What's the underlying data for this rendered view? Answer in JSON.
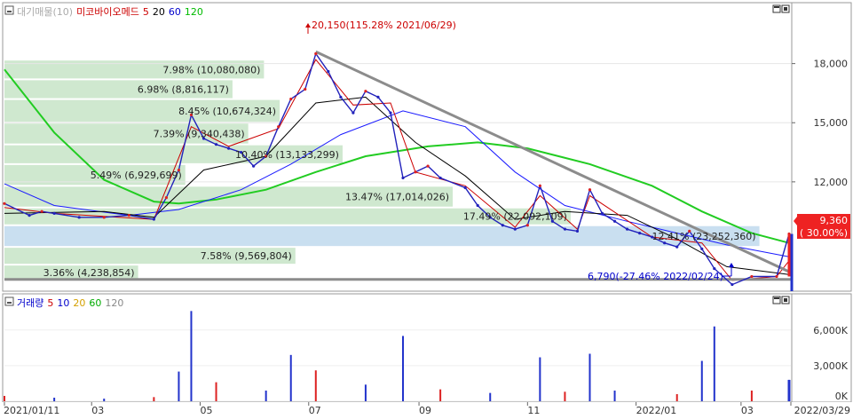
{
  "price_panel": {
    "legend": [
      {
        "text": "대기매물(10)",
        "color": "#aaaaaa"
      },
      {
        "text": "미코바이오메드",
        "color": "#cc0000"
      },
      {
        "text": "5",
        "color": "#cc0000"
      },
      {
        "text": "20",
        "color": "#000000"
      },
      {
        "text": "60",
        "color": "#0000cc"
      },
      {
        "text": "120",
        "color": "#00bb00"
      }
    ],
    "y_ticks": [
      {
        "value": 18000,
        "label": "18,000"
      },
      {
        "value": 15000,
        "label": "15,000"
      },
      {
        "value": 12000,
        "label": "12,000"
      }
    ],
    "high_label": "20,150(115.28% 2021/06/29)",
    "low_label": "6,790(-27.46% 2022/02/24)",
    "current_price": "9,360",
    "current_change": "( 30.00%)"
  },
  "volume_panel": {
    "legend": [
      {
        "text": "거래량",
        "color": "#0000cc"
      },
      {
        "text": "5",
        "color": "#cc0000"
      },
      {
        "text": "10",
        "color": "#0000cc"
      },
      {
        "text": "20",
        "color": "#d4a000"
      },
      {
        "text": "60",
        "color": "#00aa00"
      },
      {
        "text": "120",
        "color": "#888888"
      }
    ],
    "y_ticks": [
      {
        "value": 6000000,
        "label": "6,000K"
      },
      {
        "value": 3000000,
        "label": "3,000K"
      },
      {
        "value": 0,
        "label": "0K"
      }
    ]
  },
  "x_axis": {
    "labels": [
      "2021/01/11",
      "03",
      "05",
      "07",
      "09",
      "11",
      "2022/01",
      "03",
      "2022/03/29"
    ]
  },
  "chart_data": {
    "type": "line",
    "date_range": [
      "2021/01/11",
      "2022/03/29"
    ],
    "price_ylim": [
      6500,
      21000
    ],
    "volume_ylim": [
      0,
      8000000
    ],
    "price_series": [
      {
        "date": "2021/01/11",
        "close": 10900
      },
      {
        "date": "2021/01/25",
        "close": 10300
      },
      {
        "date": "2021/02/01",
        "close": 10500
      },
      {
        "date": "2021/02/08",
        "close": 10400
      },
      {
        "date": "2021/02/22",
        "close": 10200
      },
      {
        "date": "2021/03/08",
        "close": 10200
      },
      {
        "date": "2021/03/22",
        "close": 10300
      },
      {
        "date": "2021/04/05",
        "close": 10100
      },
      {
        "date": "2021/04/12",
        "close": 11200
      },
      {
        "date": "2021/04/19",
        "close": 12600
      },
      {
        "date": "2021/04/26",
        "close": 15400
      },
      {
        "date": "2021/05/03",
        "close": 14200
      },
      {
        "date": "2021/05/10",
        "close": 13900
      },
      {
        "date": "2021/05/17",
        "close": 13700
      },
      {
        "date": "2021/05/24",
        "close": 13500
      },
      {
        "date": "2021/05/31",
        "close": 12800
      },
      {
        "date": "2021/06/07",
        "close": 13300
      },
      {
        "date": "2021/06/14",
        "close": 14800
      },
      {
        "date": "2021/06/21",
        "close": 16200
      },
      {
        "date": "2021/06/29",
        "close": 16700
      },
      {
        "date": "2021/07/05",
        "close": 18500
      },
      {
        "date": "2021/07/12",
        "close": 17600
      },
      {
        "date": "2021/07/19",
        "close": 16300
      },
      {
        "date": "2021/07/26",
        "close": 15500
      },
      {
        "date": "2021/08/02",
        "close": 16600
      },
      {
        "date": "2021/08/09",
        "close": 16300
      },
      {
        "date": "2021/08/16",
        "close": 15500
      },
      {
        "date": "2021/08/23",
        "close": 12200
      },
      {
        "date": "2021/08/30",
        "close": 12500
      },
      {
        "date": "2021/09/06",
        "close": 12800
      },
      {
        "date": "2021/09/13",
        "close": 12200
      },
      {
        "date": "2021/09/27",
        "close": 11700
      },
      {
        "date": "2021/10/04",
        "close": 10800
      },
      {
        "date": "2021/10/11",
        "close": 10200
      },
      {
        "date": "2021/10/18",
        "close": 9800
      },
      {
        "date": "2021/10/25",
        "close": 9600
      },
      {
        "date": "2021/11/01",
        "close": 9800
      },
      {
        "date": "2021/11/08",
        "close": 11800
      },
      {
        "date": "2021/11/15",
        "close": 10000
      },
      {
        "date": "2021/11/22",
        "close": 9600
      },
      {
        "date": "2021/11/29",
        "close": 9500
      },
      {
        "date": "2021/12/06",
        "close": 11600
      },
      {
        "date": "2021/12/13",
        "close": 10400
      },
      {
        "date": "2021/12/20",
        "close": 10000
      },
      {
        "date": "2021/12/27",
        "close": 9600
      },
      {
        "date": "2022/01/03",
        "close": 9400
      },
      {
        "date": "2022/01/10",
        "close": 9200
      },
      {
        "date": "2022/01/17",
        "close": 8900
      },
      {
        "date": "2022/01/24",
        "close": 8700
      },
      {
        "date": "2022/01/31",
        "close": 9500
      },
      {
        "date": "2022/02/07",
        "close": 8600
      },
      {
        "date": "2022/02/14",
        "close": 7600
      },
      {
        "date": "2022/02/24",
        "close": 6790
      },
      {
        "date": "2022/03/07",
        "close": 7200
      },
      {
        "date": "2022/03/21",
        "close": 7200
      },
      {
        "date": "2022/03/28",
        "close": 9360
      }
    ],
    "ma120": [
      {
        "date": "2021/01/11",
        "value": 17700
      },
      {
        "date": "2021/02/08",
        "value": 14500
      },
      {
        "date": "2021/03/08",
        "value": 12100
      },
      {
        "date": "2021/04/05",
        "value": 11000
      },
      {
        "date": "2021/04/19",
        "value": 10900
      },
      {
        "date": "2021/05/10",
        "value": 11100
      },
      {
        "date": "2021/06/07",
        "value": 11600
      },
      {
        "date": "2021/07/05",
        "value": 12500
      },
      {
        "date": "2021/08/02",
        "value": 13300
      },
      {
        "date": "2021/09/06",
        "value": 13800
      },
      {
        "date": "2021/10/04",
        "value": 14000
      },
      {
        "date": "2021/11/01",
        "value": 13700
      },
      {
        "date": "2021/12/06",
        "value": 12900
      },
      {
        "date": "2022/01/10",
        "value": 11800
      },
      {
        "date": "2022/02/07",
        "value": 10500
      },
      {
        "date": "2022/03/07",
        "value": 9400
      },
      {
        "date": "2022/03/28",
        "value": 8900
      }
    ],
    "ma60": [
      {
        "date": "2021/01/11",
        "value": 11900
      },
      {
        "date": "2021/02/08",
        "value": 10800
      },
      {
        "date": "2021/03/22",
        "value": 10300
      },
      {
        "date": "2021/04/19",
        "value": 10600
      },
      {
        "date": "2021/05/24",
        "value": 11600
      },
      {
        "date": "2021/06/21",
        "value": 12900
      },
      {
        "date": "2021/07/19",
        "value": 14400
      },
      {
        "date": "2021/08/23",
        "value": 15600
      },
      {
        "date": "2021/09/27",
        "value": 14800
      },
      {
        "date": "2021/10/25",
        "value": 12500
      },
      {
        "date": "2021/11/22",
        "value": 10800
      },
      {
        "date": "2021/12/27",
        "value": 10000
      },
      {
        "date": "2022/01/24",
        "value": 9400
      },
      {
        "date": "2022/02/21",
        "value": 8800
      },
      {
        "date": "2022/03/28",
        "value": 8200
      }
    ],
    "ma20": [
      {
        "date": "2021/01/11",
        "value": 10400
      },
      {
        "date": "2021/03/08",
        "value": 10500
      },
      {
        "date": "2021/04/05",
        "value": 10200
      },
      {
        "date": "2021/05/03",
        "value": 12600
      },
      {
        "date": "2021/06/07",
        "value": 13300
      },
      {
        "date": "2021/07/05",
        "value": 16000
      },
      {
        "date": "2021/08/02",
        "value": 16300
      },
      {
        "date": "2021/08/30",
        "value": 14000
      },
      {
        "date": "2021/09/27",
        "value": 12300
      },
      {
        "date": "2021/10/25",
        "value": 10100
      },
      {
        "date": "2021/11/22",
        "value": 10500
      },
      {
        "date": "2021/12/27",
        "value": 10300
      },
      {
        "date": "2022/01/24",
        "value": 9100
      },
      {
        "date": "2022/02/21",
        "value": 7700
      },
      {
        "date": "2022/03/28",
        "value": 7300
      }
    ],
    "ma5": [
      {
        "date": "2021/01/11",
        "value": 10700
      },
      {
        "date": "2021/02/08",
        "value": 10400
      },
      {
        "date": "2021/04/05",
        "value": 10100
      },
      {
        "date": "2021/04/26",
        "value": 14800
      },
      {
        "date": "2021/05/17",
        "value": 13800
      },
      {
        "date": "2021/06/14",
        "value": 14700
      },
      {
        "date": "2021/07/05",
        "value": 18200
      },
      {
        "date": "2021/07/26",
        "value": 15900
      },
      {
        "date": "2021/08/16",
        "value": 16000
      },
      {
        "date": "2021/08/30",
        "value": 12500
      },
      {
        "date": "2021/09/27",
        "value": 11800
      },
      {
        "date": "2021/10/25",
        "value": 9700
      },
      {
        "date": "2021/11/08",
        "value": 11300
      },
      {
        "date": "2021/11/29",
        "value": 9600
      },
      {
        "date": "2021/12/06",
        "value": 11300
      },
      {
        "date": "2022/01/10",
        "value": 9200
      },
      {
        "date": "2022/02/07",
        "value": 8900
      },
      {
        "date": "2022/02/24",
        "value": 7000
      },
      {
        "date": "2022/03/21",
        "value": 7200
      },
      {
        "date": "2022/03/28",
        "value": 8000
      }
    ],
    "volume_profile": [
      {
        "price_low": 7000,
        "price_high": 7800,
        "label": "3.36% (4,238,854)",
        "share": 0.17
      },
      {
        "price_low": 7800,
        "price_high": 8700,
        "label": "7.58% (9,569,804)",
        "share": 0.37
      },
      {
        "price_low": 8700,
        "price_high": 9800,
        "label": "12.41% (23,252,360)",
        "share": 0.96,
        "highlight": true
      },
      {
        "price_low": 9800,
        "price_high": 10700,
        "label": "17.49% (22,092,109)",
        "share": 0.72
      },
      {
        "price_low": 10700,
        "price_high": 11800,
        "label": "13.47% (17,014,026)",
        "share": 0.57
      },
      {
        "price_low": 11800,
        "price_high": 12900,
        "label": "5.49% (6,929,699)",
        "share": 0.23
      },
      {
        "price_low": 12900,
        "price_high": 13900,
        "label": "10.40% (13,133,299)",
        "share": 0.43
      },
      {
        "price_low": 13900,
        "price_high": 15000,
        "label": "7.39% (9,340,438)",
        "share": 0.31
      },
      {
        "price_low": 15000,
        "price_high": 16200,
        "label": "8.45% (10,674,324)",
        "share": 0.35
      },
      {
        "price_low": 16200,
        "price_high": 17200,
        "label": "6.98% (8,816,117)",
        "share": 0.29
      },
      {
        "price_low": 17200,
        "price_high": 18200,
        "label": "7.98% (10,080,080)",
        "share": 0.33
      }
    ],
    "trendlines": [
      {
        "from": {
          "date": "2021/07/05",
          "value": 18600
        },
        "to": {
          "date": "2022/03/29",
          "value": 7400
        }
      },
      {
        "from": {
          "date": "2021/01/11",
          "value": 7050
        },
        "to": {
          "date": "2022/03/29",
          "value": 7050
        }
      }
    ],
    "volume_series": [
      {
        "date": "2021/01/11",
        "volume": 450000
      },
      {
        "date": "2021/02/08",
        "volume": 300000
      },
      {
        "date": "2021/03/08",
        "volume": 220000
      },
      {
        "date": "2021/04/05",
        "volume": 350000
      },
      {
        "date": "2021/04/19",
        "volume": 2500000
      },
      {
        "date": "2021/04/26",
        "volume": 7600000
      },
      {
        "date": "2021/05/10",
        "volume": 1600000
      },
      {
        "date": "2021/06/07",
        "volume": 900000
      },
      {
        "date": "2021/06/21",
        "volume": 3900000
      },
      {
        "date": "2021/07/05",
        "volume": 2600000
      },
      {
        "date": "2021/08/02",
        "volume": 1400000
      },
      {
        "date": "2021/08/23",
        "volume": 5500000
      },
      {
        "date": "2021/09/13",
        "volume": 1000000
      },
      {
        "date": "2021/10/11",
        "volume": 700000
      },
      {
        "date": "2021/11/08",
        "volume": 3700000
      },
      {
        "date": "2021/11/22",
        "volume": 800000
      },
      {
        "date": "2021/12/06",
        "volume": 4000000
      },
      {
        "date": "2021/12/20",
        "volume": 900000
      },
      {
        "date": "2022/01/24",
        "volume": 600000
      },
      {
        "date": "2022/02/07",
        "volume": 3400000
      },
      {
        "date": "2022/02/14",
        "volume": 6300000
      },
      {
        "date": "2022/03/07",
        "volume": 900000
      },
      {
        "date": "2022/03/28",
        "volume": 1800000
      }
    ]
  }
}
